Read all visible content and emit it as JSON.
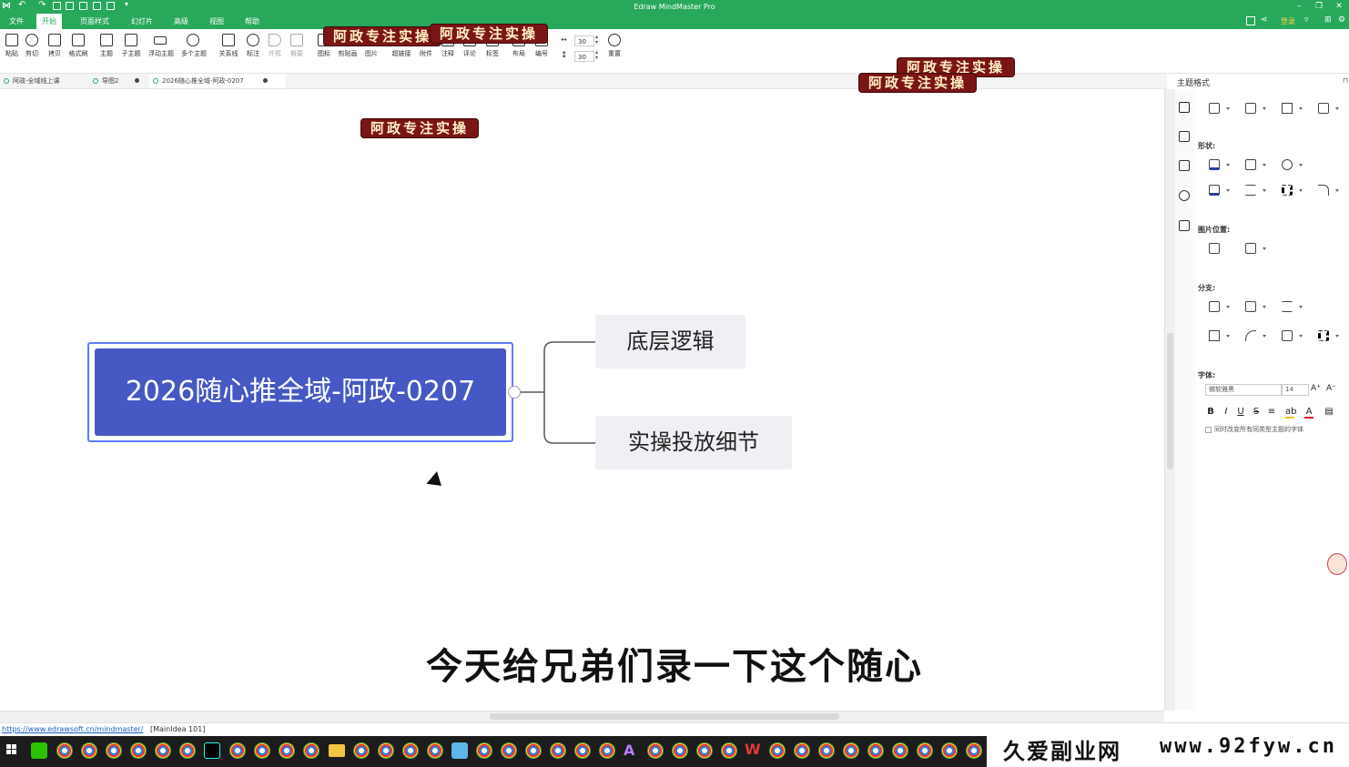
{
  "app": {
    "title": "Edraw MindMaster Pro"
  },
  "menu": {
    "items": [
      "文件",
      "开始",
      "页面样式",
      "幻灯片",
      "高级",
      "视图",
      "帮助"
    ],
    "active_index": 1,
    "login": "登录"
  },
  "ribbon": {
    "tools": [
      {
        "label": "粘贴"
      },
      {
        "label": "剪切"
      },
      {
        "label": "拷贝"
      },
      {
        "label": "格式刷"
      },
      {
        "label": "主题"
      },
      {
        "label": "子主题"
      },
      {
        "label": "浮动主题"
      },
      {
        "label": "多个主题"
      },
      {
        "label": "关系线"
      },
      {
        "label": "标注"
      },
      {
        "label": "外框"
      },
      {
        "label": "概要"
      },
      {
        "label": "图标"
      },
      {
        "label": "剪贴画"
      },
      {
        "label": "图片"
      },
      {
        "label": "超链接"
      },
      {
        "label": "附件"
      },
      {
        "label": "注释"
      },
      {
        "label": "评论"
      },
      {
        "label": "标签"
      },
      {
        "label": "布局"
      },
      {
        "label": "编号"
      },
      {
        "label": "重置"
      }
    ],
    "spacing_h": "30",
    "spacing_v": "30"
  },
  "tabs": [
    {
      "label": "阿政-全域线上课"
    },
    {
      "label": "导图2"
    },
    {
      "label": "2026随心推全域-阿政-0207"
    }
  ],
  "watermarks": [
    "阿政专注实操",
    "阿政专注实操",
    "阿政专注实操",
    "阿政专注实操",
    "阿政专注实操"
  ],
  "mindmap": {
    "main": "2026随心推全域-阿政-0207",
    "subs": [
      "底层逻辑",
      "实操投放细节"
    ]
  },
  "subtitle": "今天给兄弟们录一下这个随心",
  "panel": {
    "title": "主题格式",
    "shape_label": "形状:",
    "image_pos_label": "图片位置:",
    "branch_label": "分支:",
    "font_label": "字体:",
    "font_name": "微软雅黑",
    "font_size": "14",
    "font_checkbox": "同时改变所有同类型主题的字体"
  },
  "status": {
    "link": "https://www.edrawsoft.cn/mindmaster/",
    "info": "[MainIdea 101]"
  },
  "site_watermark": {
    "left": "久爱副业网",
    "right": "www.92fyw.cn"
  },
  "colors": {
    "brand": "#27a85a",
    "main_topic": "#4658c3",
    "watermark_bg": "#7a1515"
  }
}
